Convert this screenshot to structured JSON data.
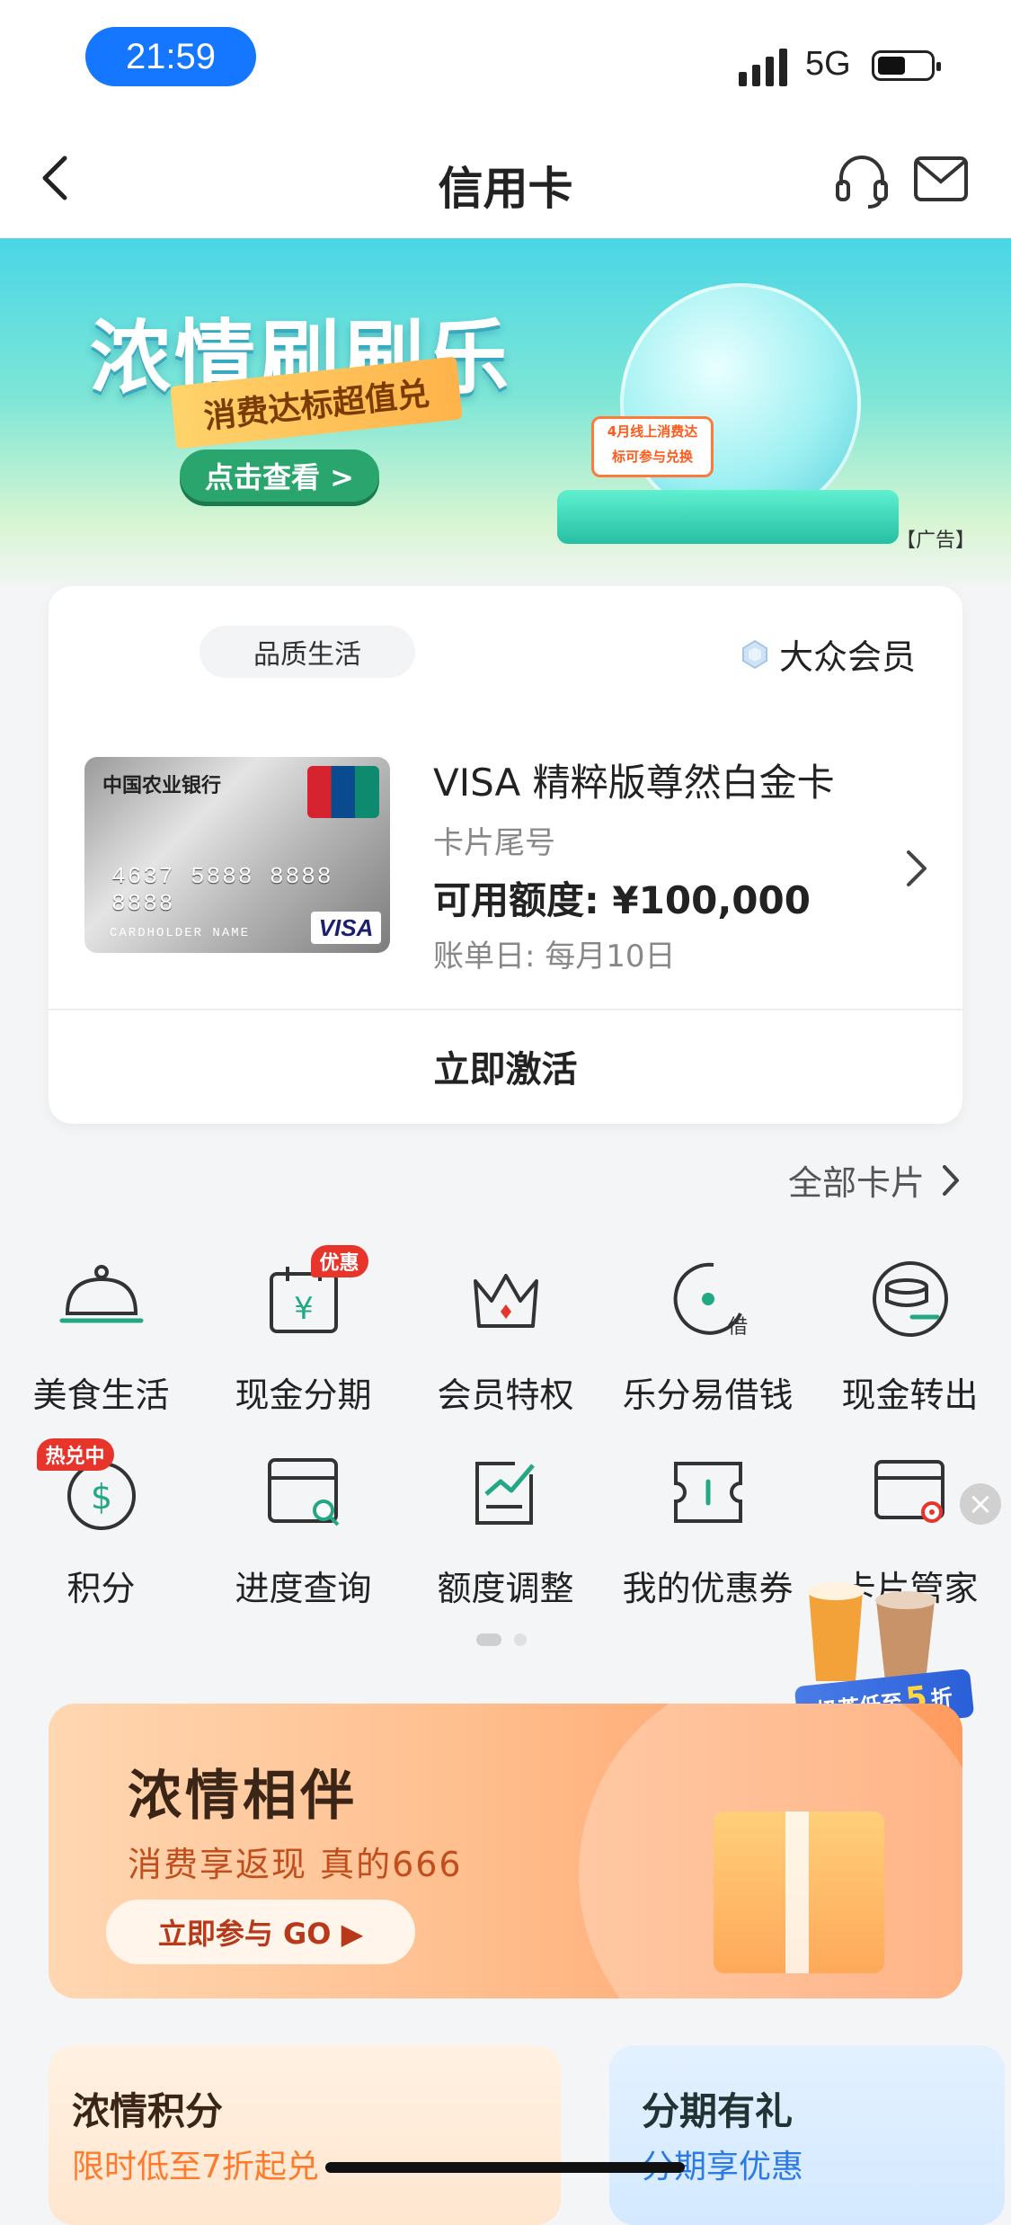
{
  "status": {
    "time": "21:59",
    "network": "5G"
  },
  "nav": {
    "title": "信用卡"
  },
  "banner": {
    "title": "浓情刷刷乐",
    "ribbon": "消费达标超值兑",
    "cta": "点击查看 >",
    "tag_line1": "4月线上消费达",
    "tag_line2": "标可参与兑换",
    "ad_label": "【广告】"
  },
  "card": {
    "category": "品质生活",
    "member_level": "大众会员",
    "bank_name": "中国农业银行",
    "card_number_display": "4637 5888 8888 8888",
    "cardholder": "CARDHOLDER NAME",
    "network_logo": "VISA",
    "name": "VISA 精粹版尊然白金卡",
    "tail_label": "卡片尾号",
    "credit_limit": "可用额度: ¥100,000",
    "bill_day": "账单日: 每月10日",
    "activate_label": "立即激活"
  },
  "all_cards_label": "全部卡片",
  "grid": {
    "row1": [
      {
        "label": "美食生活",
        "icon": "cloche-icon"
      },
      {
        "label": "现金分期",
        "icon": "calendar-yuan-icon",
        "badge": "优惠"
      },
      {
        "label": "会员特权",
        "icon": "crown-icon"
      },
      {
        "label": "乐分易借钱",
        "icon": "borrow-icon"
      },
      {
        "label": "现金转出",
        "icon": "coin-transfer-icon"
      }
    ],
    "row2": [
      {
        "label": "积分",
        "icon": "points-icon",
        "badge": "热兑中"
      },
      {
        "label": "进度查询",
        "icon": "progress-search-icon"
      },
      {
        "label": "额度调整",
        "icon": "limit-adjust-icon"
      },
      {
        "label": "我的优惠券",
        "icon": "coupon-icon"
      },
      {
        "label": "卡片管家",
        "icon": "card-settings-icon"
      }
    ]
  },
  "tea_promo": {
    "prefix": "奶茶低至",
    "number": "5",
    "suffix": "折"
  },
  "promo": {
    "title": "浓情相伴",
    "subtitle": "消费享返现 真的666",
    "button": "立即参与 GO ▶"
  },
  "bottom": {
    "left_title": "浓情积分",
    "left_sub": "限时低至7折起兑",
    "right_title": "分期有礼",
    "right_sub": "分期享优惠"
  }
}
